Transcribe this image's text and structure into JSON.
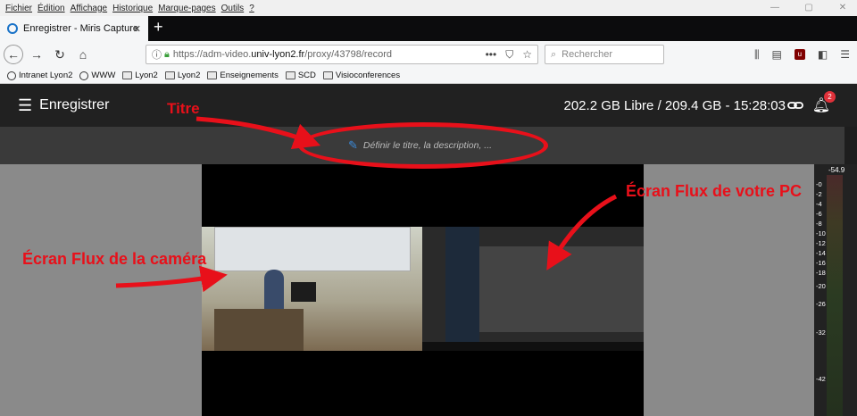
{
  "menubar": {
    "items": [
      "Fichier",
      "Édition",
      "Affichage",
      "Historique",
      "Marque-pages",
      "Outils",
      "?"
    ]
  },
  "window_controls": [
    "—",
    "▢",
    "✕"
  ],
  "tab": {
    "title": "Enregistrer - Miris Capture",
    "close": "✕"
  },
  "newtab": "+",
  "url": {
    "prefix": "https://adm-video.",
    "host": "univ-lyon2.fr",
    "path": "/proxy/43798/record"
  },
  "url_actions": [
    "•••",
    "⛉",
    "☆"
  ],
  "search": {
    "placeholder": "Rechercher"
  },
  "toolbar_icons": [
    "library-icon",
    "sidebar-icon",
    "ublock-icon",
    "screenshot-icon",
    "menu-icon"
  ],
  "bookmarks": [
    {
      "label": "Intranet Lyon2",
      "icon": "globe"
    },
    {
      "label": "WWW",
      "icon": "globe"
    },
    {
      "label": "Lyon2",
      "icon": "folder"
    },
    {
      "label": "Lyon2",
      "icon": "folder"
    },
    {
      "label": "Enseignements",
      "icon": "folder"
    },
    {
      "label": "SCD",
      "icon": "folder"
    },
    {
      "label": "Visioconferences",
      "icon": "folder"
    }
  ],
  "app": {
    "title": "Enregistrer",
    "status": "202.2 GB Libre / 209.4 GB - 15:28:03",
    "notifications": "2",
    "title_placeholder": "Définir le titre, la description, ..."
  },
  "vumeter": {
    "peak": "-54.9",
    "scale": [
      "-0",
      "-2",
      "-4",
      "-6",
      "-8",
      "-10",
      "-12",
      "-14",
      "-16",
      "-18",
      "-20",
      "-26",
      "-32",
      "-42"
    ]
  },
  "annotations": {
    "title": "Titre",
    "pc": "Écran Flux de votre PC",
    "camera": "Écran Flux de la caméra"
  },
  "colors": {
    "annotation": "#e8101a",
    "appbar": "#212121",
    "badge": "#e0313a",
    "pen": "#3b8ad9"
  }
}
